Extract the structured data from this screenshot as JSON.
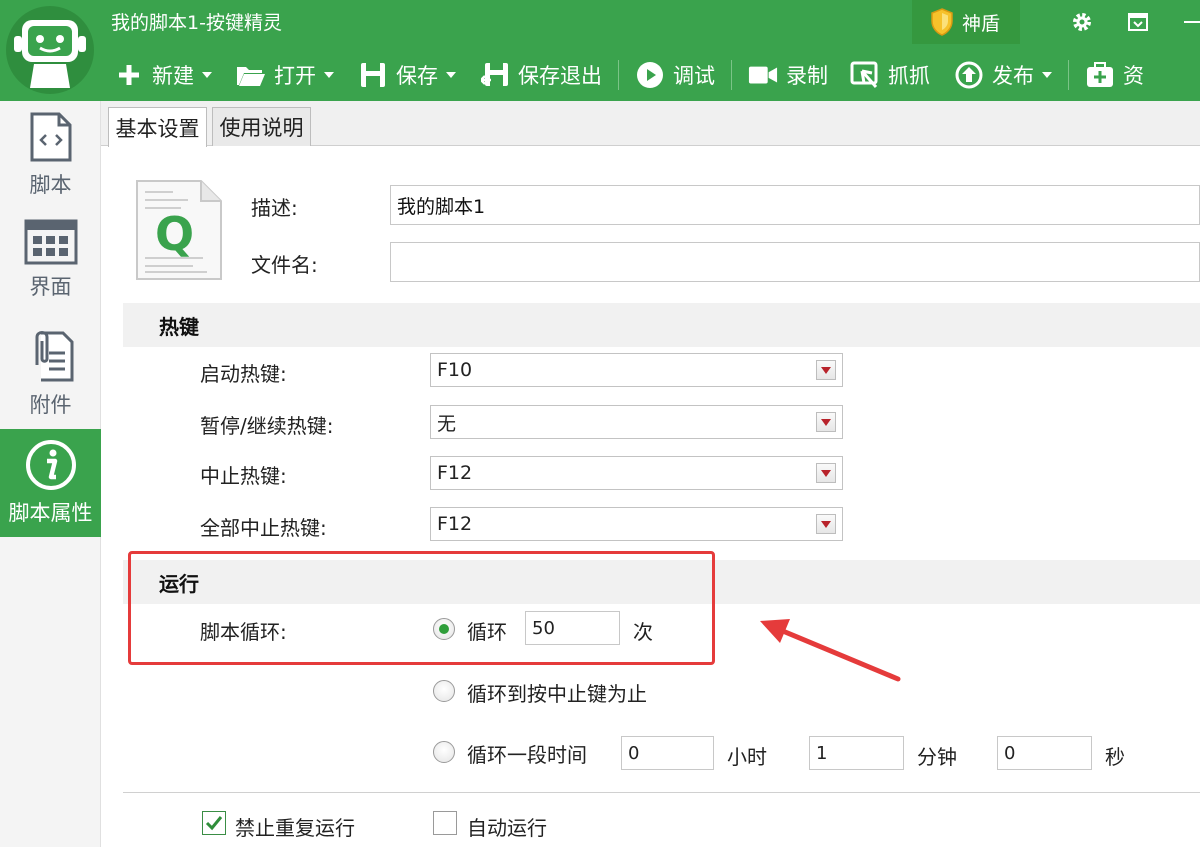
{
  "app": {
    "title": "我的脚本1-按键精灵",
    "shield_label": "神盾"
  },
  "toolbar": {
    "items": [
      {
        "label": "新建",
        "icon": "plus-icon",
        "dropdown": true
      },
      {
        "label": "打开",
        "icon": "folder-icon",
        "dropdown": true
      },
      {
        "label": "保存",
        "icon": "save-icon",
        "dropdown": true
      },
      {
        "label": "保存退出",
        "icon": "save-exit-icon",
        "dropdown": false
      },
      {
        "label": "调试",
        "icon": "play-icon",
        "dropdown": false
      },
      {
        "label": "录制",
        "icon": "camera-icon",
        "dropdown": false
      },
      {
        "label": "抓抓",
        "icon": "grab-icon",
        "dropdown": false
      },
      {
        "label": "发布",
        "icon": "publish-icon",
        "dropdown": true
      },
      {
        "label": "资",
        "icon": "resource-icon",
        "dropdown": false
      }
    ]
  },
  "sidebar": {
    "items": [
      {
        "label": "脚本",
        "icon": "script-file-icon",
        "active": false
      },
      {
        "label": "界面",
        "icon": "grid-icon",
        "active": false
      },
      {
        "label": "附件",
        "icon": "attachment-icon",
        "active": false
      },
      {
        "label": "脚本属性",
        "icon": "info-icon",
        "active": true
      }
    ]
  },
  "tabs": [
    {
      "label": "基本设置",
      "active": true
    },
    {
      "label": "使用说明",
      "active": false
    }
  ],
  "form": {
    "description_label": "描述:",
    "description_value": "我的脚本1",
    "filename_label": "文件名:",
    "filename_value": ""
  },
  "hotkeys": {
    "section_title": "热键",
    "rows": [
      {
        "label": "启动热键:",
        "value": "F10"
      },
      {
        "label": "暂停/继续热键:",
        "value": "无"
      },
      {
        "label": "中止热键:",
        "value": "F12"
      },
      {
        "label": "全部中止热键:",
        "value": "F12"
      }
    ]
  },
  "run": {
    "section_title": "运行",
    "loop_label": "脚本循环:",
    "options": {
      "loop_count_label": "循环",
      "loop_count_value": "50",
      "loop_count_unit": "次",
      "until_stop_label": "循环到按中止键为止",
      "duration_label": "循环一段时间",
      "hours_value": "0",
      "hours_unit": "小时",
      "minutes_value": "1",
      "minutes_unit": "分钟",
      "seconds_value": "0",
      "seconds_unit": "秒"
    },
    "selected": "loop_count"
  },
  "checkboxes": {
    "no_repeat_label": "禁止重复运行",
    "no_repeat_checked": true,
    "auto_run_label": "自动运行",
    "auto_run_checked": false
  },
  "colors": {
    "brand_green": "#3aa34d",
    "highlight_red": "#e53b3b"
  }
}
